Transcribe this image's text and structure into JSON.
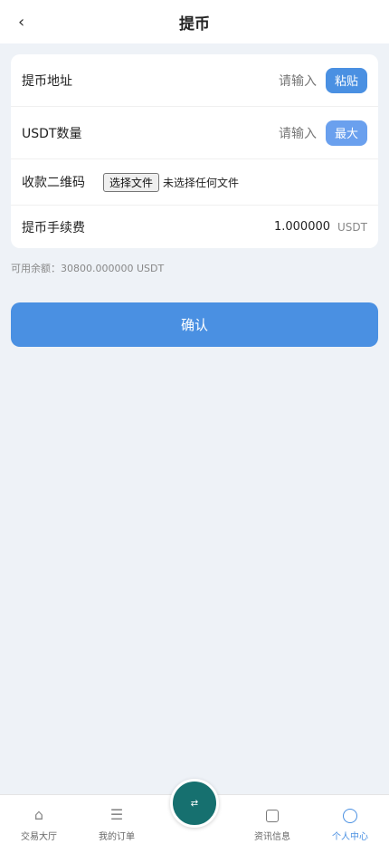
{
  "header": {
    "title": "提币",
    "back_icon": "‹"
  },
  "form": {
    "address": {
      "label": "提币地址",
      "placeholder": "请输入",
      "button": "粘贴"
    },
    "amount": {
      "label": "USDT数量",
      "placeholder": "请输入",
      "button": "最大"
    },
    "qrcode": {
      "label": "收款二维码",
      "file_button": "选择文件",
      "file_status": "未选择任何文件"
    },
    "fee": {
      "label": "提币手续费",
      "value": "1.000000",
      "unit": "USDT"
    }
  },
  "balance_text": "可用余额：30800.000000 USDT",
  "confirm_label": "确认",
  "tabbar": {
    "items": [
      {
        "label": "交易大厅",
        "icon": "⌂"
      },
      {
        "label": "我的订单",
        "icon": "☰"
      },
      {
        "label": "资讯信息",
        "icon": ""
      },
      {
        "label": "个人中心",
        "icon": ""
      }
    ],
    "center_icon": "⇄"
  },
  "colors": {
    "primary": "#4a90e2",
    "center": "#16706f",
    "bg": "#eef2f7"
  }
}
